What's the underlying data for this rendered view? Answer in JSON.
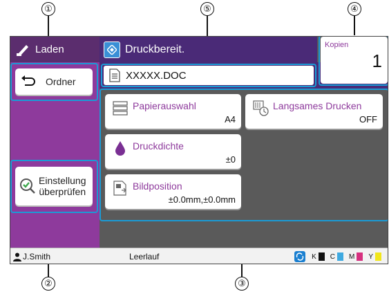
{
  "callouts": [
    "①",
    "②",
    "③",
    "④",
    "⑤"
  ],
  "mode_tab": {
    "label": "Laden",
    "icon": "pen-icon"
  },
  "folder_button": {
    "label": "Ordner",
    "icon": "back-arrow-icon"
  },
  "check_button": {
    "line1": "Einstellung",
    "line2": "überprüfen",
    "icon": "check-magnifier-icon"
  },
  "header": {
    "status": "Druckbereit.",
    "icon": "diamond-status-icon"
  },
  "file": {
    "name": "XXXXX.DOC",
    "icon": "document-icon"
  },
  "copies": {
    "label": "Kopien",
    "value": "1"
  },
  "functions": [
    {
      "label": "Papierauswahl",
      "value": "A4",
      "icon": "paper-tray-icon"
    },
    {
      "label": "Langsames Drucken",
      "value": "OFF",
      "icon": "slow-print-icon"
    },
    {
      "label": "Druckdichte",
      "value": "±0",
      "icon": "ink-drop-icon"
    },
    {
      "label": "Bildposition",
      "value": "±0.0mm,±0.0mm",
      "icon": "image-position-icon"
    }
  ],
  "status_bar": {
    "user": "J.Smith",
    "state": "Leerlauf",
    "toner": [
      {
        "label": "K",
        "color": "#111111"
      },
      {
        "label": "C",
        "color": "#3fa9e0"
      },
      {
        "label": "M",
        "color": "#d6307f"
      },
      {
        "label": "Y",
        "color": "#f2e61b"
      }
    ]
  },
  "colors": {
    "accent_purple": "#8e3a9c",
    "highlight_blue": "#1a9bd6",
    "header_purple": "#4a2a77"
  }
}
